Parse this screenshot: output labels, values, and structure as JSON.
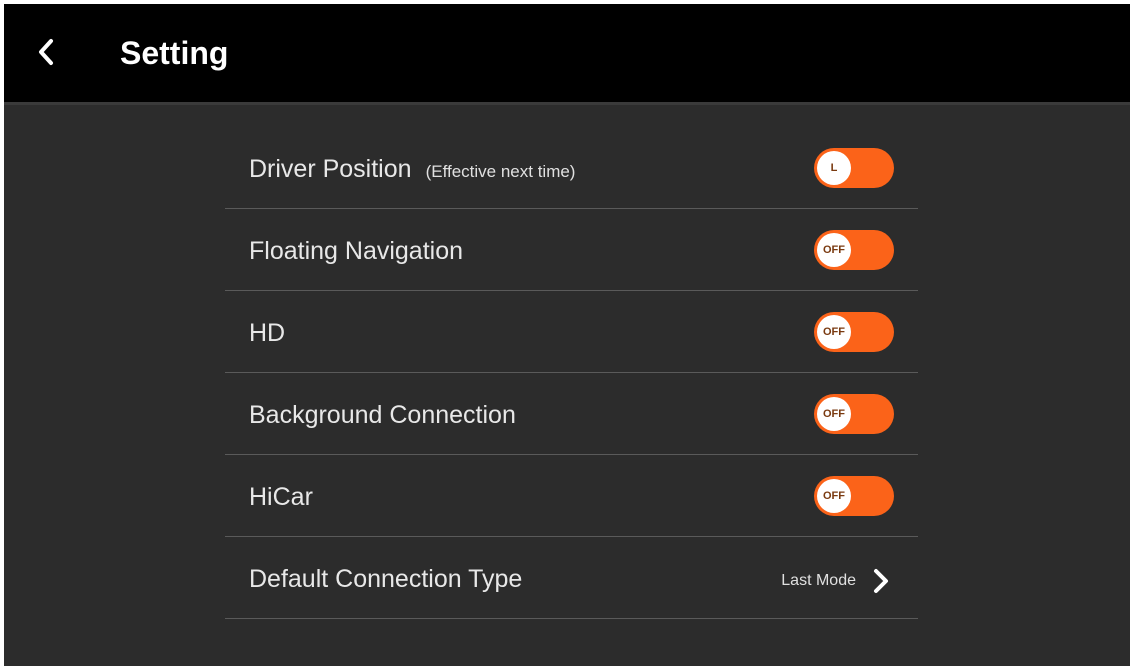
{
  "header": {
    "title": "Setting",
    "back_icon": "chevron-left-icon"
  },
  "settings": [
    {
      "label": "Driver Position",
      "hint": "(Effective next time)",
      "control": "toggle",
      "state_label": "L"
    },
    {
      "label": "Floating Navigation",
      "control": "toggle",
      "state_label": "OFF"
    },
    {
      "label": "HD",
      "control": "toggle",
      "state_label": "OFF"
    },
    {
      "label": "Background Connection",
      "control": "toggle",
      "state_label": "OFF"
    },
    {
      "label": "HiCar",
      "control": "toggle",
      "state_label": "OFF"
    },
    {
      "label": "Default Connection Type",
      "control": "link",
      "value": "Last Mode",
      "icon": "chevron-right-icon"
    }
  ],
  "colors": {
    "background": "#2c2c2c",
    "header": "#000000",
    "accent": "#fb6319",
    "text": "#e8e8e8",
    "divider": "#5a5a5a"
  }
}
